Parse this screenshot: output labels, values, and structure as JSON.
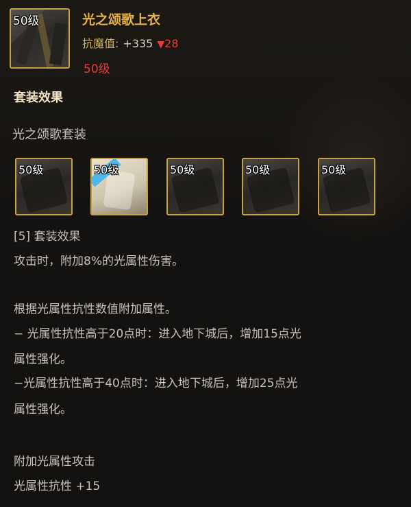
{
  "item": {
    "level_badge": "50级",
    "name": "光之颂歌上衣",
    "stat_label": "抗魔值:",
    "stat_value": "+335",
    "stat_diff": "28",
    "required_level": "50级"
  },
  "set_effect_title": "套装效果",
  "set_name": "光之颂歌套装",
  "set_items": [
    {
      "level_badge": "50级",
      "icon": "jacket-icon"
    },
    {
      "level_badge": "50级",
      "icon": "pants-icon"
    },
    {
      "level_badge": "50级",
      "icon": "shoulder-icon"
    },
    {
      "level_badge": "50级",
      "icon": "belt-icon"
    },
    {
      "level_badge": "50级",
      "icon": "shoes-icon"
    }
  ],
  "effect_lines": [
    "[5] 套装效果",
    "攻击时，附加8%的光属性伤害。",
    "根据光属性抗性数值附加属性。",
    "− 光属性抗性高于20点时：进入地下城后，增加15点光",
    "属性强化。",
    "−光属性抗性高于40点时：进入地下城后，增加25点光",
    "属性强化。",
    "附加光属性攻击",
    "光属性抗性 +15"
  ],
  "colors": {
    "title_gold": "#e8b34a",
    "frame_gold": "#c6a244",
    "negative_red": "#e0403a",
    "body_text": "#c8c3b8",
    "background": "#151311"
  }
}
